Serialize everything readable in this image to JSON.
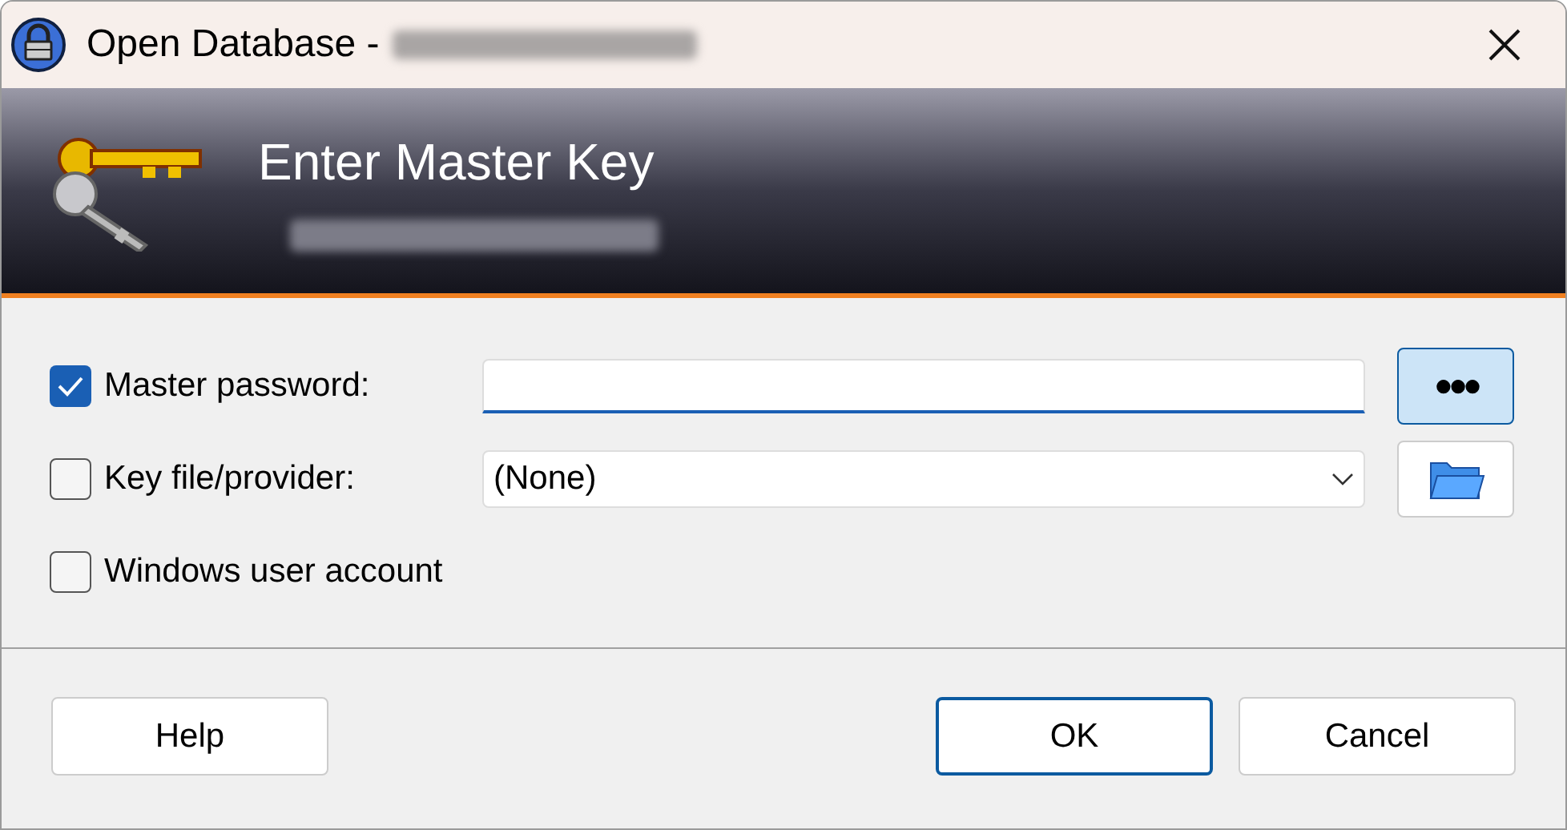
{
  "window": {
    "title": "Open Database -"
  },
  "banner": {
    "title": "Enter Master Key"
  },
  "options": [
    {
      "kind": "password",
      "label": "Master password:",
      "checked": true,
      "toggle": {
        "text": "●●●",
        "pressed": true
      }
    },
    {
      "kind": "dropdown",
      "label": "Key file/provider:",
      "checked": false,
      "value": "(None)"
    },
    {
      "kind": "plain",
      "label": "Windows user account",
      "checked": false
    }
  ],
  "buttons": [
    {
      "label": "Help",
      "default": false
    },
    {
      "label": "OK",
      "default": true
    },
    {
      "label": "Cancel",
      "default": false
    }
  ]
}
